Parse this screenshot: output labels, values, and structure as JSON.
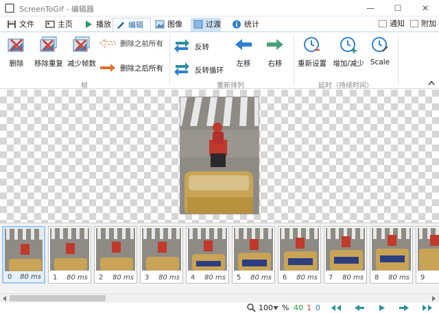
{
  "window": {
    "title": "ScreenToGif - 编辑器",
    "minimize": "—",
    "maximize": "☐",
    "close": "✕"
  },
  "tabs": [
    {
      "label": "文件",
      "icon": "save-icon"
    },
    {
      "label": "主页",
      "icon": "home-icon"
    },
    {
      "label": "播放",
      "icon": "play-icon"
    },
    {
      "label": "编辑",
      "icon": "pencil-icon"
    },
    {
      "label": "图像",
      "icon": "image-icon"
    },
    {
      "label": "过渡",
      "icon": "transition-icon"
    },
    {
      "label": "统计",
      "icon": "info-icon"
    }
  ],
  "options": {
    "notify": "通知",
    "attach": "附加"
  },
  "ribbon": {
    "frames": {
      "delete": "删除",
      "remove_duplicates": "移除重复",
      "reduce_frames": "减少帧数",
      "delete_before": "删除之前所有",
      "delete_after": "删除之后所有",
      "group": "帧"
    },
    "reorder": {
      "reverse": "反转",
      "yoyo": "反转循环",
      "move_left": "左移",
      "move_right": "右移",
      "group": "重新排列"
    },
    "delay": {
      "reset": "重新设置",
      "increase_decrease": "增加/减少",
      "scale": "Scale",
      "group": "延时（持续时间）"
    }
  },
  "colors": {
    "accent": "#1b5fa8",
    "red": "#d9432f",
    "orange": "#e0702e",
    "teal": "#2a8fa0",
    "blue": "#2f7fd0",
    "green": "#4ca07c"
  },
  "frames": [
    {
      "n": "0",
      "ms": "80 ms"
    },
    {
      "n": "1",
      "ms": "80 ms"
    },
    {
      "n": "2",
      "ms": "80 ms"
    },
    {
      "n": "3",
      "ms": "80 ms"
    },
    {
      "n": "4",
      "ms": "80 ms"
    },
    {
      "n": "5",
      "ms": "80 ms"
    },
    {
      "n": "6",
      "ms": "80 ms"
    },
    {
      "n": "7",
      "ms": "80 ms"
    },
    {
      "n": "8",
      "ms": "80 ms"
    },
    {
      "n": "9",
      "ms": "80"
    }
  ],
  "status": {
    "zoom": "100",
    "percent": "%",
    "total": "40",
    "selected": "1",
    "current": "0"
  }
}
